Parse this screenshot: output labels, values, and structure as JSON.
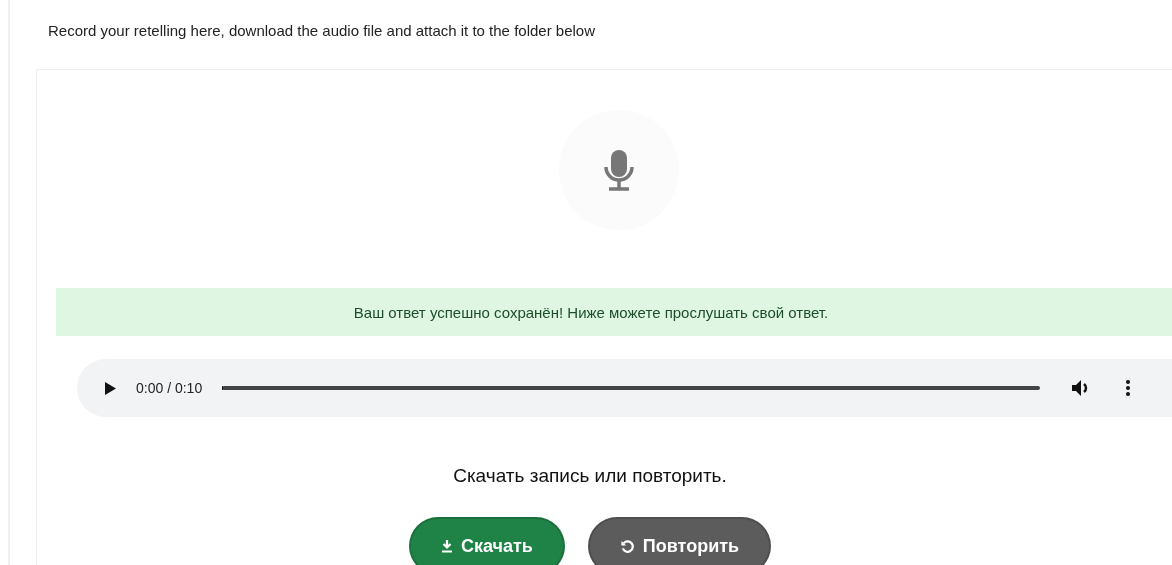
{
  "instruction": "Record your retelling here, download the audio file and attach it to the folder below",
  "recorder": {
    "status_message": "Ваш ответ успешно сохранён! Ниже можете прослушать свой ответ.",
    "player": {
      "time": "0:00 / 0:10",
      "level": 0
    },
    "prompt": "Скачать запись или повторить.",
    "buttons": [
      {
        "kind": "download",
        "label": "Скачать"
      },
      {
        "kind": "retry",
        "label": "Повторить"
      }
    ]
  }
}
